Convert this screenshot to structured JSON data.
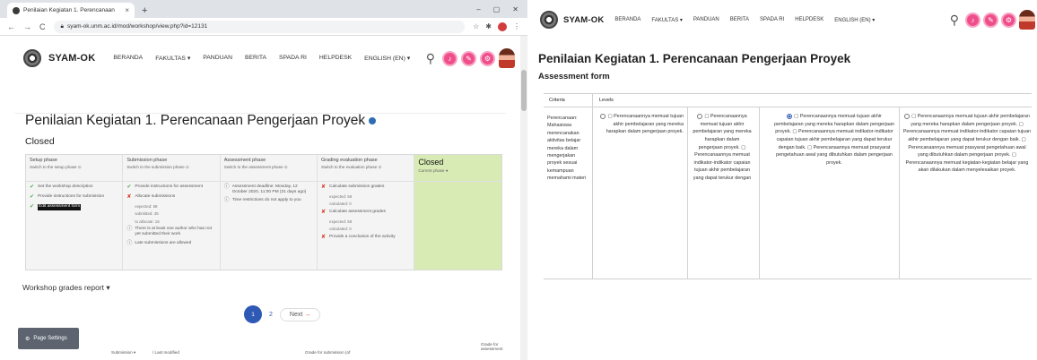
{
  "browser": {
    "tab_title": "Penilaian Kegiatan 1. Perencanaan",
    "tab_close": "×",
    "new_tab": "+",
    "window_controls": [
      "–",
      "▢",
      "✕"
    ],
    "nav_buttons": [
      "←",
      "→",
      "C"
    ],
    "url": "syam-ok.unm.ac.id/mod/workshop/view.php?id=12131"
  },
  "site": {
    "brand": "SYAM-OK",
    "menu": [
      "BERANDA",
      "FAKULTAS ▾",
      "PANDUAN",
      "BERITA",
      "SPADA RI",
      "HELPDESK",
      "ENGLISH (EN) ▾"
    ]
  },
  "left": {
    "page_title": "Penilaian Kegiatan 1. Perencanaan Pengerjaan Proyek",
    "status": "Closed",
    "phases": [
      {
        "title": "Setup phase",
        "sub": "Switch to the setup phase ⊙",
        "tasks": [
          {
            "mark": "✔",
            "kind": "ok",
            "text": "Set the workshop description"
          },
          {
            "mark": "✔",
            "kind": "ok",
            "text": "Provide instructions for submission"
          },
          {
            "mark": "✔",
            "kind": "ok",
            "text": "Edit assessment form",
            "highlight": true
          }
        ]
      },
      {
        "title": "Submission phase",
        "sub": "Switch to the submission phase ⊙",
        "tasks": [
          {
            "mark": "✔",
            "kind": "ok",
            "text": "Provide instructions for assessment"
          },
          {
            "mark": "✘",
            "kind": "err",
            "text": "Allocate submissions",
            "details": [
              "expected: 58",
              "submitted: 35",
              "to allocate: 15"
            ]
          },
          {
            "mark": "ⓘ",
            "kind": "info",
            "text": "There is at least one author who has not yet submitted their work"
          },
          {
            "mark": "ⓘ",
            "kind": "info",
            "text": "Late submissions are allowed"
          }
        ]
      },
      {
        "title": "Assessment phase",
        "sub": "Switch to the assessment phase ⊙",
        "tasks": [
          {
            "mark": "ⓘ",
            "kind": "info",
            "text": "Assessment deadline: Monday, 12 October 2020, 11:00 PM (31 days ago)"
          },
          {
            "mark": "ⓘ",
            "kind": "info",
            "text": "Time restrictions do not apply to you"
          }
        ]
      },
      {
        "title": "Grading evaluation phase",
        "sub": "Switch to the evaluation phase ⊙",
        "tasks": [
          {
            "mark": "✘",
            "kind": "err",
            "text": "Calculate submission grades",
            "details": [
              "expected: 58",
              "calculated: 0"
            ]
          },
          {
            "mark": "✘",
            "kind": "err",
            "text": "Calculate assessment grades",
            "details": [
              "expected: 58",
              "calculated: 0"
            ]
          },
          {
            "mark": "✘",
            "kind": "err",
            "text": "Provide a conclusion of the activity"
          }
        ]
      },
      {
        "title": "Closed",
        "sub": "Current phase ●",
        "active": true,
        "tasks": []
      }
    ],
    "grades_report": "Workshop grades report ▾",
    "pagination": {
      "page1": "1",
      "page2": "2",
      "next": "Next",
      "next_arrow": "→"
    },
    "page_settings": "Page Settings",
    "bottom_cols": [
      "Submission ▾",
      "/ Last modified",
      "Grade for submission (of",
      "Grade for assessment"
    ]
  },
  "right": {
    "page_title": "Penilaian Kegiatan 1. Perencanaan Pengerjaan Proyek",
    "section": "Assessment form",
    "col_criteria": "Criteria",
    "col_levels": "Levels",
    "criterion": "Perencanaan: Mahasiswa merencanakan aktivitas belajar mereka dalam mengerjakan proyek sesuai kemampuan memahami materi",
    "levels": [
      {
        "text": "▢ Perencanaannya memuat tujuan akhir pembelajaran yang mereka harapkan dalam pengerjaan proyek.",
        "selected": false
      },
      {
        "text": "▢ Perencanaannya memuat tujuan akhir pembelajaran yang mereka harapkan dalam pengerjaan proyek. ▢ Perencanaannya memuat indikator-indikator capaian tujuan akhir pembelajaran yang dapat terukur dengan",
        "selected": false
      },
      {
        "text": "▢ Perencanaannya memuat tujuan akhir pembelajaran yang mereka harapkan dalam pengerjaan proyek. ▢ Perencanaannya memuat indikator-indikator capaian tujuan akhir pembelajaran yang dapat terukur dengan baik. ▢ Perencanaannya memuat prasyarat pengetahuan awal yang dibutuhkan dalam pengerjaan proyek.",
        "selected": true
      },
      {
        "text": "▢ Perencanaannya memuat tujuan akhir pembelajaran yang mereka harapkan dalam pengerjaan proyek. ▢ Perencanaannya memuat indikator-indikator capaian tujuan akhir pembelajaran yang dapat terukur dengan baik. ▢ Perencanaannya memuat prasyarat pengetahuan awal yang dibutuhkan dalam pengerjaan proyek. ▢ Perencanaannya memuat kegiatan-kegiatan belajar yang akan dilakukan dalam menyelesaikan proyek.",
        "selected": false
      }
    ]
  },
  "colors": {
    "accent": "#2e59b4",
    "closed_phase": "#d8ebb4",
    "notification": "#ef4e8a",
    "ok": "#4caf50",
    "error": "#d9331f"
  },
  "icons": [
    "search-icon",
    "bell-icon",
    "chat-icon",
    "settings-icon",
    "user-avatar",
    "help-icon",
    "gear-icon"
  ]
}
